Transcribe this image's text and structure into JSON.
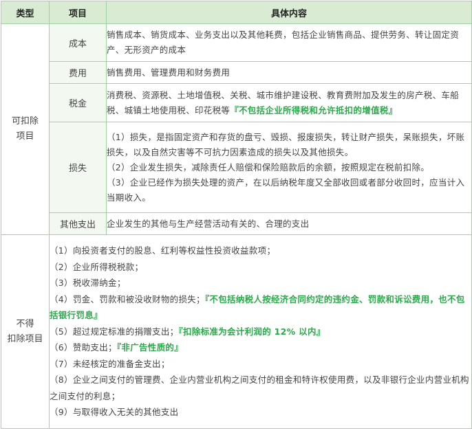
{
  "header": {
    "type": "类型",
    "item": "项目",
    "content": "具体内容"
  },
  "deductible": {
    "category_line1": "可扣除",
    "category_line2": "项目",
    "rows": [
      {
        "item": "成本",
        "text": "销售成本、销货成本、业务支出以及其他耗费，包括企业销售商品、提供劳务、转让固定资产、无形资产的成本"
      },
      {
        "item": "费用",
        "text": "销售费用、管理费用和财务费用"
      },
      {
        "item": "税金",
        "text": "消费税、资源税、土地增值税、关税、城市维护建设税、教育费附加及发生的房产税、车船税、城镇土地使用税、印花税等",
        "note": "『不包括企业所得税和允许抵扣的增值税』"
      },
      {
        "item": "损失",
        "lines": [
          "（1）损失，是指固定资产和存货的盘亏、毁损、报废损失，转让财产损失，呆账损失，坏账损失，以及自然灾害等不可抗力因素造成的损失以及其他损失。",
          "（2）企业发生损失，减除责任人赔偿和保险赔款后的余额，按照规定在税前扣除。",
          "（3）企业已经作为损失处理的资产，在以后纳税年度又全部收回或者部分收回时，应当计入当期收入。"
        ]
      },
      {
        "item": "其他支出",
        "text": "企业发生的其他与生产经营活动有关的、合理的支出"
      }
    ]
  },
  "non_deductible": {
    "category_line1": "不得",
    "category_line2": "扣除项目",
    "lines": [
      {
        "text": "（1）向投资者支付的股息、红利等权益性投资收益款项；",
        "note": ""
      },
      {
        "text": "（2）企业所得税税款；",
        "note": ""
      },
      {
        "text": "（3）税收滞纳金；",
        "note": ""
      },
      {
        "text": "（4）罚金、罚款和被没收财物的损失；",
        "note": "『不包括纳税人按经济合同约定的违约金、罚款和诉讼费用，也不包括银行罚息』"
      },
      {
        "text": "（5）超过规定标准的捐赠支出；",
        "note": "『扣除标准为会计利润的 12% 以内』"
      },
      {
        "text": "（6）赞助支出；",
        "note": "『非广告性质的』"
      },
      {
        "text": "（7）未经核定的准备金支出；",
        "note": ""
      },
      {
        "text": "（8）企业之间支付的管理费、企业内营业机构之间支付的租金和特许权使用费，以及非银行企业内营业机构之间支付的利息；",
        "note": ""
      },
      {
        "text": "（9）与取得收入无关的其他支出",
        "note": ""
      }
    ]
  },
  "colors": {
    "border": "#9bd3a5",
    "header_bg": "#d9ecd3",
    "note": "#2aa94a"
  }
}
